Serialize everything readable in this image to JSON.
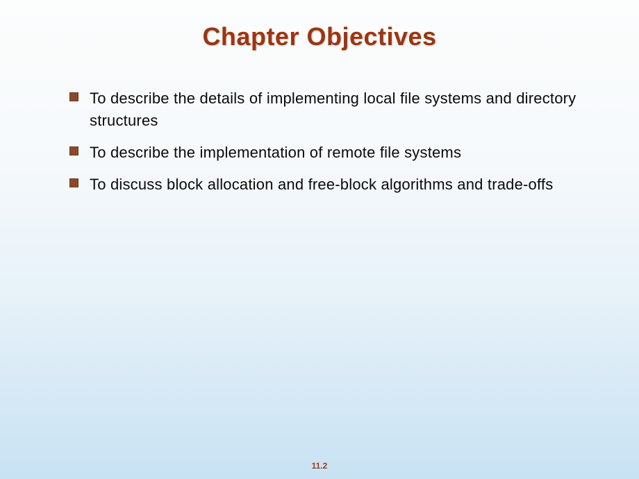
{
  "title": "Chapter Objectives",
  "bullets": [
    "To describe the details of implementing local file systems and directory structures",
    "To describe the implementation of remote file systems",
    "To discuss block allocation and free-block algorithms and trade-offs"
  ],
  "pageNumber": "11.2"
}
